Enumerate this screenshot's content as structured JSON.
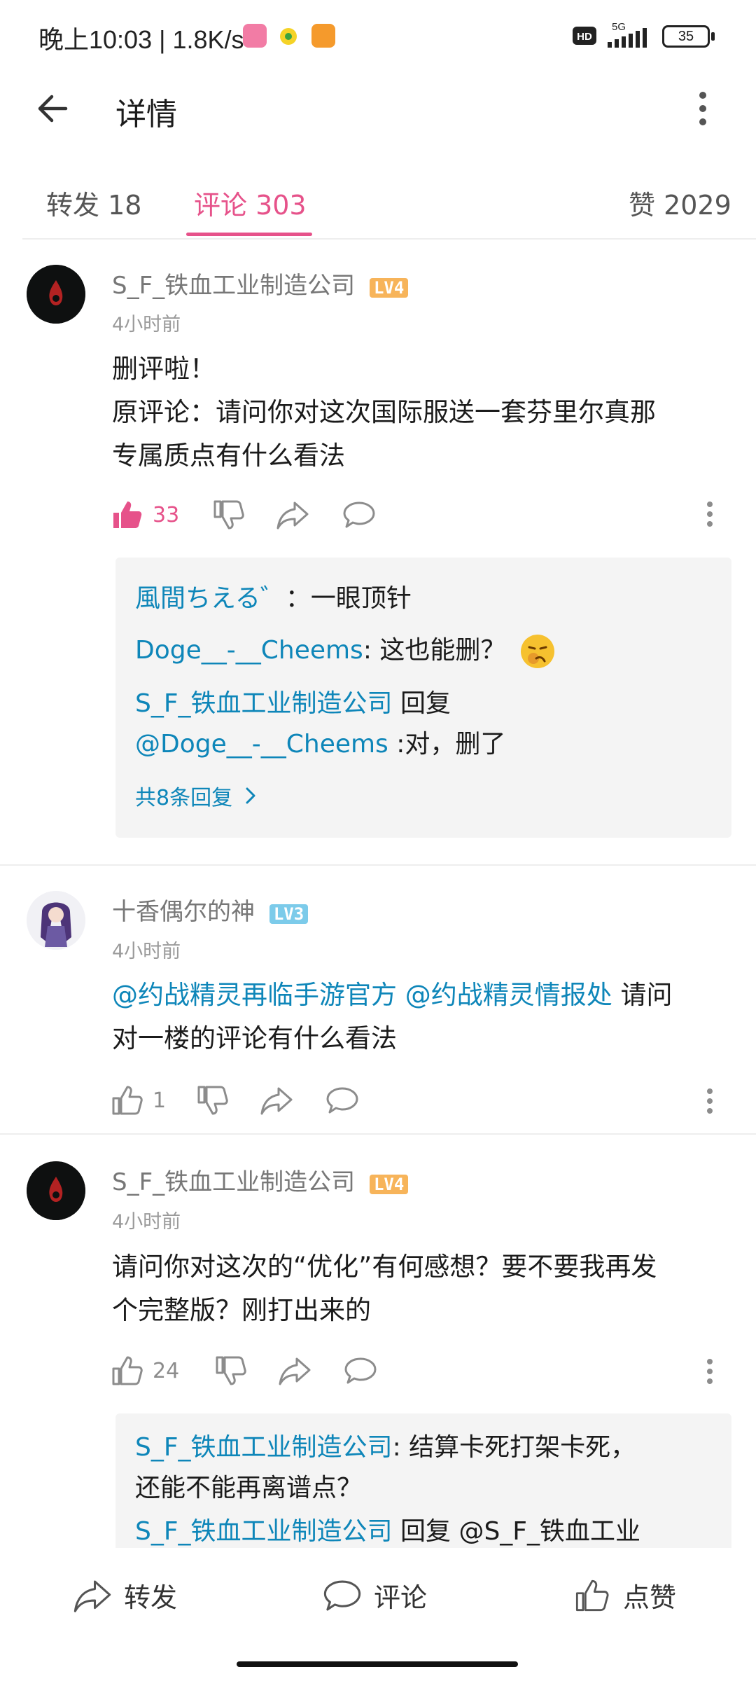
{
  "status_bar": {
    "time": "晚上10:03",
    "speed": "1.8K/s",
    "network": "5G",
    "battery": "35"
  },
  "header": {
    "title": "详情"
  },
  "tabs": [
    {
      "label": "转发 18"
    },
    {
      "label": "评论 303"
    },
    {
      "label": "赞 2029"
    }
  ],
  "comments": [
    {
      "author": "S_F_铁血工业制造公司",
      "level": "LV4",
      "time": "4小时前",
      "text_line1": "删评啦！",
      "text_line2": "原评论：请问你对这次国际服送一套芬里尔真那",
      "text_line3": "专属质点有什么看法",
      "likes": "33",
      "replies": [
        {
          "user": "風間ちえる゛",
          "text": "：一眼顶针"
        },
        {
          "user": "Doge__-__Cheems",
          "text": ": 这也能删？"
        },
        {
          "user": "S_F_铁血工业制造公司",
          "text": " 回复",
          "mention": "@Doge__-__Cheems",
          "text2": " :对，删了"
        }
      ],
      "more": "共8条回复"
    },
    {
      "author": "十香偶尔的神",
      "level": "LV3",
      "time": "4小时前",
      "mention1": "@约战精灵再临手游官方",
      "mention2": "@约战精灵情报处",
      "text_line1_tail": " 请问",
      "text_line2": "对一楼的评论有什么看法",
      "likes": "1"
    },
    {
      "author": "S_F_铁血工业制造公司",
      "level": "LV4",
      "time": "4小时前",
      "text_line1": "请问你对这次的“优化”有何感想？要不要我再发",
      "text_line2": "个完整版？刚打出来的",
      "likes": "24",
      "replies": [
        {
          "user": "S_F_铁血工业制造公司",
          "text": ": 结算卡死打架卡死，",
          "text2": "还能不能再离谱点？"
        },
        {
          "user": "S_F_铁血工业制造公司",
          "text": " 回复 @S_F_铁血工业"
        }
      ]
    }
  ],
  "bottom_bar": {
    "forward": "转发",
    "comment": "评论",
    "like": "点赞"
  },
  "colors": {
    "accent_pink": "#e6528a",
    "link_blue": "#0e86b9",
    "lv4_orange": "#f7b45a",
    "lv3_blue": "#7ccbea"
  }
}
